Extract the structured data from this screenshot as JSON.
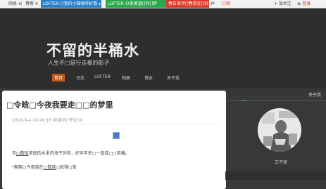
{
  "topbar": {
    "menu1": "网易",
    "menu2": "博客",
    "tab_blue": "LOFTER·[]我的小猫咖啡好看 ▸",
    "tab_green": "LOFTER·分享黄昏[]有[]梦",
    "tab_red": "春日草坪[]春游在[]好",
    "shuffle_icon": "shuffle-icon",
    "subscribe": "订阅",
    "follow": "+ 加关注",
    "login": "登录"
  },
  "header": {
    "title": "不留的半桶水",
    "subtitle": "人生不□是行走着的影子"
  },
  "nav": {
    "items": [
      "首页",
      "日志",
      "LOFTER",
      "相册",
      "博友",
      "关于我"
    ]
  },
  "post": {
    "title": "□令晗□今夜我要走□□的梦里",
    "meta": "2016-6-4 18:49:16     阅读(8)     评论(0)",
    "line1_pre": "去",
    "line1_link": "□数晗",
    "line1_post": "草园的水里的海子的你，好多年来□一直成□□前播。",
    "line2_pre": "*期期□今夜我在",
    "line2_link": "□数晗",
    "line2_post": "□就得□草"
  },
  "sidebar": {
    "label": "关于我",
    "name": "王不留"
  },
  "colors": {
    "accent_orange": "#c25a1e",
    "tab_blue": "#2a7fc9",
    "tab_green": "#2aa84a",
    "tab_red": "#d93a2a",
    "accent_green": "#3ec46a"
  }
}
